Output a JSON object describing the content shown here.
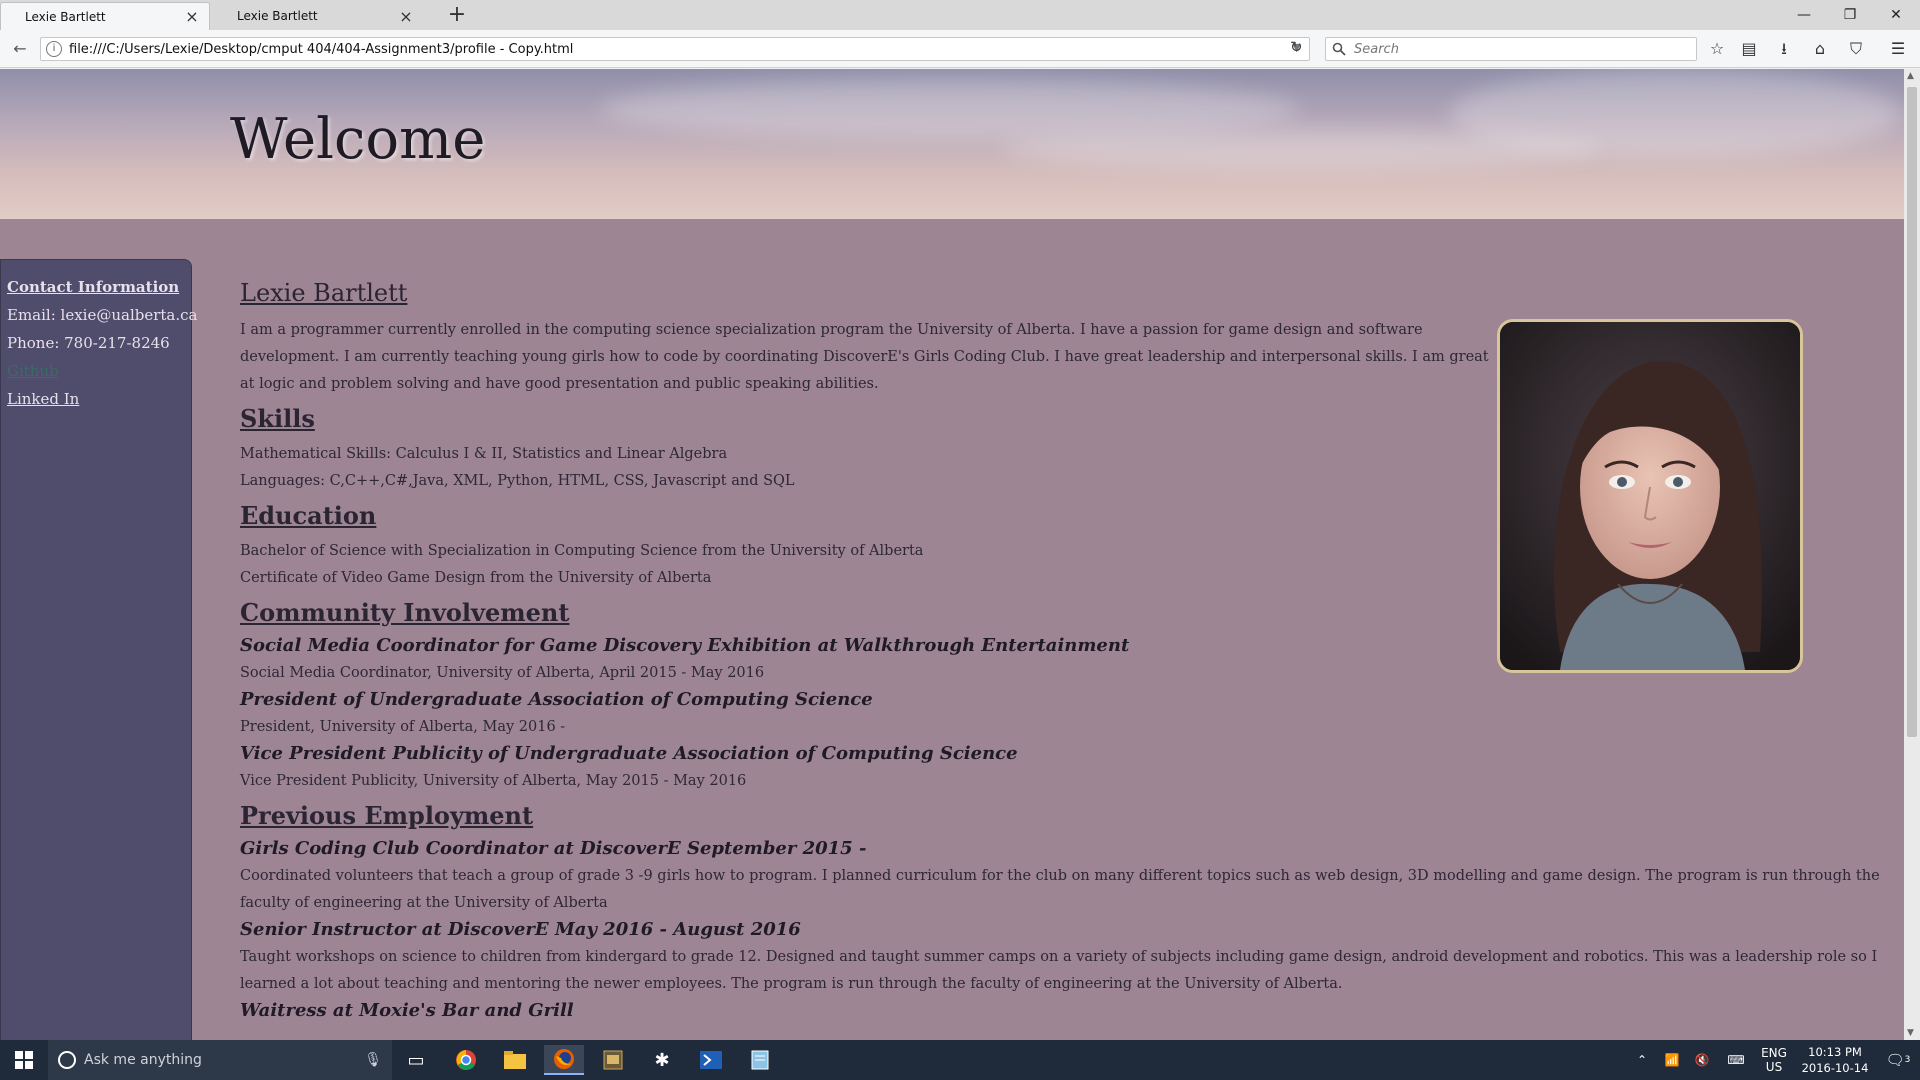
{
  "browser": {
    "tabs": [
      {
        "label": "Lexie Bartlett",
        "active": true
      },
      {
        "label": "Lexie Bartlett",
        "active": false
      }
    ],
    "url": "file:///C:/Users/Lexie/Desktop/cmput 404/404-Assignment3/profile - Copy.html",
    "search_placeholder": "Search"
  },
  "hero": {
    "title": "Welcome"
  },
  "sidebar": {
    "heading": "Contact Information",
    "email": "Email: lexie@ualberta.ca",
    "phone": "Phone: 780-217-8246",
    "github": "Github",
    "linkedin": "Linked In"
  },
  "profile": {
    "name": "Lexie Bartlett",
    "bio": "I am a programmer currently enrolled in the computing science specialization program the University of Alberta. I have a passion for game design and software development. I am currently teaching young girls how to code by coordinating DiscoverE's Girls Coding Club. I have great leadership and interpersonal skills. I am great at logic and problem solving and have good presentation and public speaking abilities."
  },
  "skills": {
    "heading": "Skills",
    "math": "Mathematical Skills: Calculus I & II, Statistics and Linear Algebra",
    "languages": "Languages: C,C++,C#,Java, XML, Python, HTML, CSS, Javascript and SQL"
  },
  "education": {
    "heading": "Education",
    "items": [
      "Bachelor of Science with Specialization in Computing Science from the University of Alberta",
      "Certificate of Video Game Design from the University of Alberta"
    ]
  },
  "community": {
    "heading": "Community Involvement",
    "roles": [
      {
        "title": "Social Media Coordinator for Game Discovery Exhibition at Walkthrough Entertainment",
        "detail": "Social Media Coordinator, University of Alberta, April 2015 - May 2016"
      },
      {
        "title": "President of Undergraduate Association of Computing Science",
        "detail": "President, University of Alberta, May 2016 -"
      },
      {
        "title": "Vice President Publicity of Undergraduate Association of Computing Science",
        "detail": "Vice President Publicity, University of Alberta, May 2015 - May 2016"
      }
    ]
  },
  "employment": {
    "heading": "Previous Employment",
    "jobs": [
      {
        "title": "Girls Coding Club Coordinator at DiscoverE September 2015 -",
        "detail": "Coordinated volunteers that teach a group of grade 3 -9 girls how to program. I planned curriculum for the club on many different topics such as web design, 3D modelling and game design. The program is run through the faculty of engineering at the University of Alberta"
      },
      {
        "title": "Senior Instructor at DiscoverE May 2016 - August 2016",
        "detail": "Taught workshops on science to children from kindergard to grade 12. Designed and taught summer camps on a variety of subjects including game design, android development and robotics. This was a leadership role so I learned a lot about teaching and mentoring the newer employees. The program is run through the faculty of engineering at the University of Alberta."
      },
      {
        "title": "Waitress at Moxie's Bar and Grill",
        "detail": ""
      }
    ]
  },
  "taskbar": {
    "search_placeholder": "Ask me anything",
    "lang": "ENG",
    "region": "US",
    "time": "10:13 PM",
    "date": "2016-10-14",
    "notifications": "3"
  },
  "colors": {
    "page_bg": "#9d8594",
    "sidebar_bg": "#4f4d6b",
    "text": "#2b2433",
    "taskbar": "#1f2a3b"
  }
}
